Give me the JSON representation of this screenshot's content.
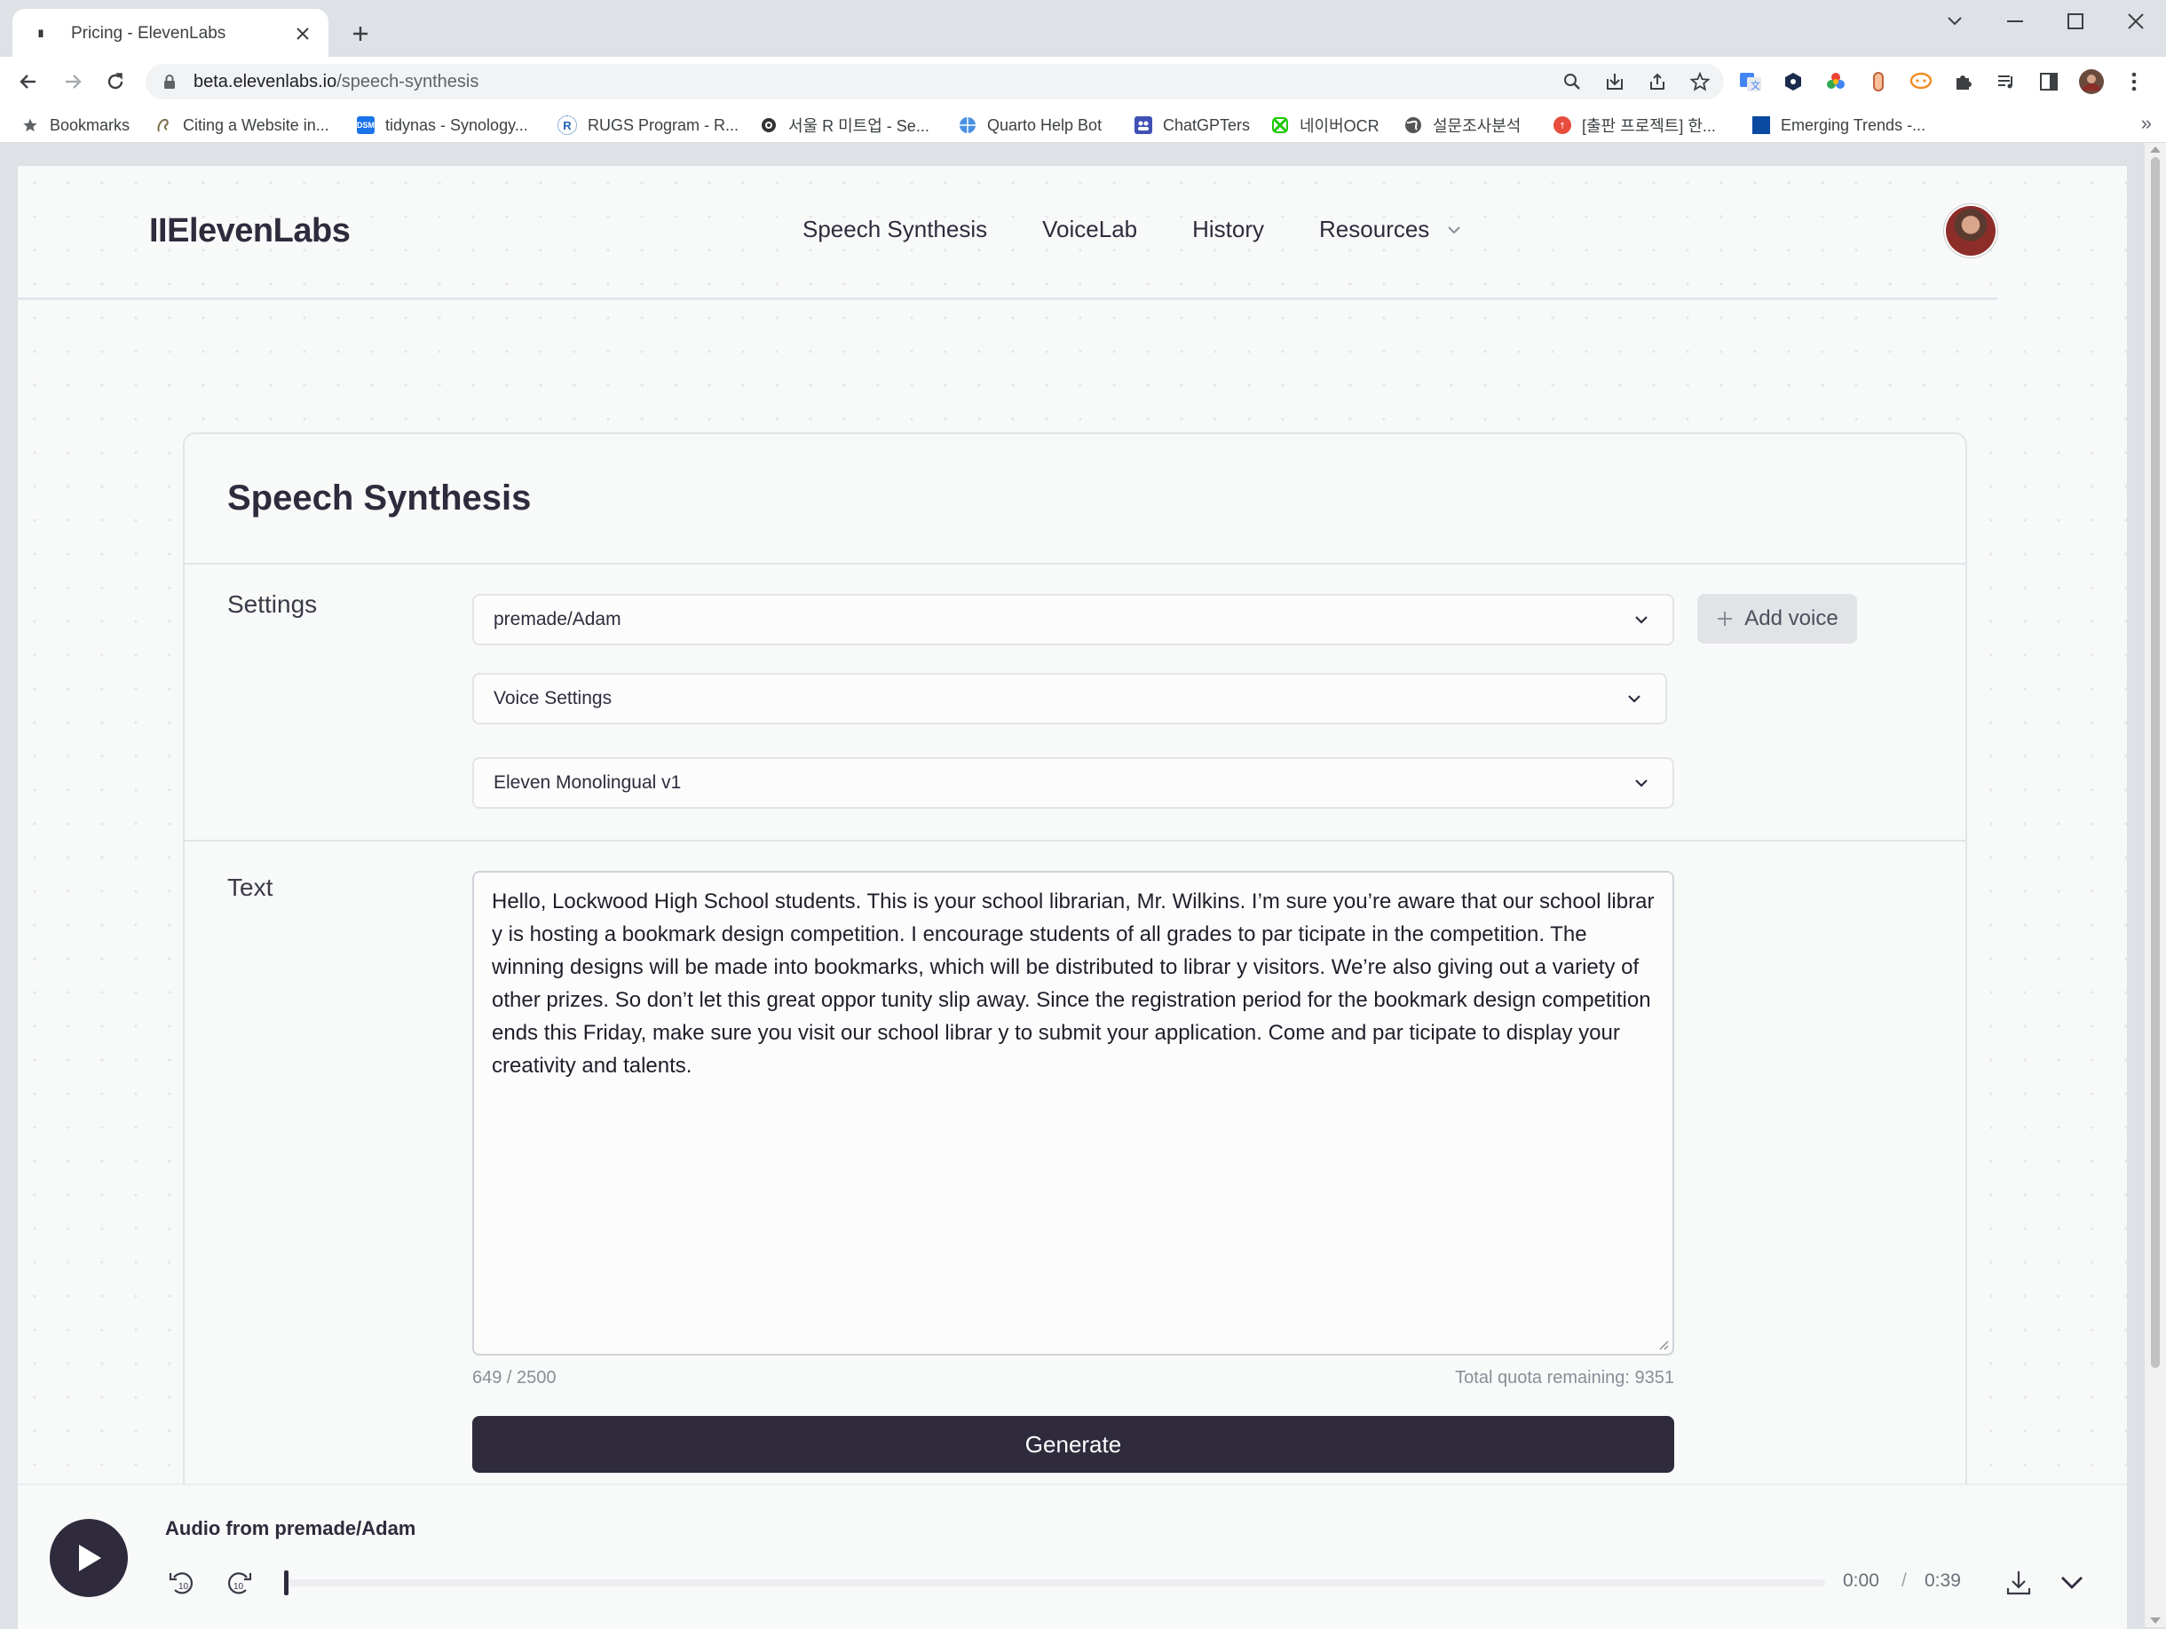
{
  "browser": {
    "tab_title": "Pricing - ElevenLabs",
    "url_domain": "beta.elevenlabs.io",
    "url_path": "/speech-synthesis",
    "bookmarks": [
      {
        "label": "Bookmarks"
      },
      {
        "label": "Citing a Website in..."
      },
      {
        "label": "tidynas - Synology..."
      },
      {
        "label": "RUGS Program - R..."
      },
      {
        "label": "서울 R 미트업 - Se..."
      },
      {
        "label": "Quarto Help Bot"
      },
      {
        "label": "ChatGPTers"
      },
      {
        "label": "네이버OCR"
      },
      {
        "label": "설문조사분석"
      },
      {
        "label": "[출판 프로젝트] 한..."
      },
      {
        "label": "Emerging Trends -..."
      }
    ],
    "bookmarks_overflow": "»"
  },
  "site": {
    "logo": "IIElevenLabs",
    "nav": [
      "Speech Synthesis",
      "VoiceLab",
      "History",
      "Resources"
    ]
  },
  "card": {
    "title": "Speech Synthesis",
    "settings_label": "Settings",
    "voice_select": "premade/Adam",
    "voice_settings_select": "Voice Settings",
    "model_select": "Eleven Monolingual v1",
    "add_voice": "Add voice",
    "text_label": "Text",
    "text_value": "Hello, Lockwood High School students. This is your school librarian, Mr. Wilkins. I’m sure you’re aware that our school librar y is hosting a bookmark design competition. I encourage students of all grades to par ticipate in the competition. The winning designs will be made into bookmarks, which will be distributed to librar y visitors. We’re also giving out a variety of other prizes. So don’t let this great oppor tunity slip away. Since the registration period for the bookmark design competition ends this Friday, make sure you visit our school librar y to submit your application. Come and par ticipate to display your creativity and talents.",
    "char_count": "649 / 2500",
    "quota": "Total quota remaining: 9351",
    "generate": "Generate"
  },
  "player": {
    "title": "Audio from premade/Adam",
    "current_time": "0:00",
    "separator": "/",
    "duration": "0:39",
    "progress": 0
  },
  "colors": {
    "brand_dark": "#2f2b3d",
    "page_bg": "#f8f9f9",
    "border": "#e2e4e8"
  },
  "icons": {
    "tab_close": "close-icon",
    "new_tab": "plus-icon",
    "back": "arrow-left-icon",
    "forward": "arrow-right-icon",
    "reload": "reload-icon",
    "secure": "lock-icon",
    "play": "play-icon",
    "rewind": "rewind-10-icon",
    "forward10": "forward-10-icon",
    "download": "download-icon",
    "collapse": "chevron-down-icon"
  }
}
